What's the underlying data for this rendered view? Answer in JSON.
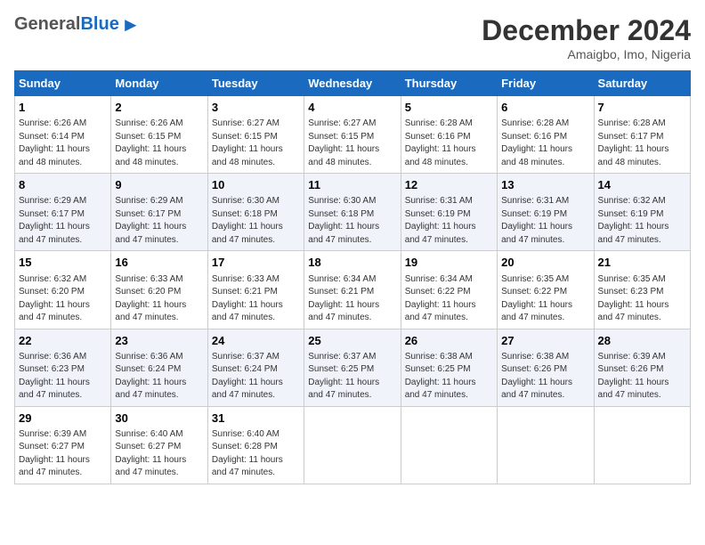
{
  "header": {
    "logo_general": "General",
    "logo_blue": "Blue",
    "month": "December 2024",
    "location": "Amaigbo, Imo, Nigeria"
  },
  "weekdays": [
    "Sunday",
    "Monday",
    "Tuesday",
    "Wednesday",
    "Thursday",
    "Friday",
    "Saturday"
  ],
  "weeks": [
    [
      {
        "day": "1",
        "sunrise": "6:26 AM",
        "sunset": "6:14 PM",
        "daylight": "11 hours and 48 minutes."
      },
      {
        "day": "2",
        "sunrise": "6:26 AM",
        "sunset": "6:15 PM",
        "daylight": "11 hours and 48 minutes."
      },
      {
        "day": "3",
        "sunrise": "6:27 AM",
        "sunset": "6:15 PM",
        "daylight": "11 hours and 48 minutes."
      },
      {
        "day": "4",
        "sunrise": "6:27 AM",
        "sunset": "6:15 PM",
        "daylight": "11 hours and 48 minutes."
      },
      {
        "day": "5",
        "sunrise": "6:28 AM",
        "sunset": "6:16 PM",
        "daylight": "11 hours and 48 minutes."
      },
      {
        "day": "6",
        "sunrise": "6:28 AM",
        "sunset": "6:16 PM",
        "daylight": "11 hours and 48 minutes."
      },
      {
        "day": "7",
        "sunrise": "6:28 AM",
        "sunset": "6:17 PM",
        "daylight": "11 hours and 48 minutes."
      }
    ],
    [
      {
        "day": "8",
        "sunrise": "6:29 AM",
        "sunset": "6:17 PM",
        "daylight": "11 hours and 47 minutes."
      },
      {
        "day": "9",
        "sunrise": "6:29 AM",
        "sunset": "6:17 PM",
        "daylight": "11 hours and 47 minutes."
      },
      {
        "day": "10",
        "sunrise": "6:30 AM",
        "sunset": "6:18 PM",
        "daylight": "11 hours and 47 minutes."
      },
      {
        "day": "11",
        "sunrise": "6:30 AM",
        "sunset": "6:18 PM",
        "daylight": "11 hours and 47 minutes."
      },
      {
        "day": "12",
        "sunrise": "6:31 AM",
        "sunset": "6:19 PM",
        "daylight": "11 hours and 47 minutes."
      },
      {
        "day": "13",
        "sunrise": "6:31 AM",
        "sunset": "6:19 PM",
        "daylight": "11 hours and 47 minutes."
      },
      {
        "day": "14",
        "sunrise": "6:32 AM",
        "sunset": "6:19 PM",
        "daylight": "11 hours and 47 minutes."
      }
    ],
    [
      {
        "day": "15",
        "sunrise": "6:32 AM",
        "sunset": "6:20 PM",
        "daylight": "11 hours and 47 minutes."
      },
      {
        "day": "16",
        "sunrise": "6:33 AM",
        "sunset": "6:20 PM",
        "daylight": "11 hours and 47 minutes."
      },
      {
        "day": "17",
        "sunrise": "6:33 AM",
        "sunset": "6:21 PM",
        "daylight": "11 hours and 47 minutes."
      },
      {
        "day": "18",
        "sunrise": "6:34 AM",
        "sunset": "6:21 PM",
        "daylight": "11 hours and 47 minutes."
      },
      {
        "day": "19",
        "sunrise": "6:34 AM",
        "sunset": "6:22 PM",
        "daylight": "11 hours and 47 minutes."
      },
      {
        "day": "20",
        "sunrise": "6:35 AM",
        "sunset": "6:22 PM",
        "daylight": "11 hours and 47 minutes."
      },
      {
        "day": "21",
        "sunrise": "6:35 AM",
        "sunset": "6:23 PM",
        "daylight": "11 hours and 47 minutes."
      }
    ],
    [
      {
        "day": "22",
        "sunrise": "6:36 AM",
        "sunset": "6:23 PM",
        "daylight": "11 hours and 47 minutes."
      },
      {
        "day": "23",
        "sunrise": "6:36 AM",
        "sunset": "6:24 PM",
        "daylight": "11 hours and 47 minutes."
      },
      {
        "day": "24",
        "sunrise": "6:37 AM",
        "sunset": "6:24 PM",
        "daylight": "11 hours and 47 minutes."
      },
      {
        "day": "25",
        "sunrise": "6:37 AM",
        "sunset": "6:25 PM",
        "daylight": "11 hours and 47 minutes."
      },
      {
        "day": "26",
        "sunrise": "6:38 AM",
        "sunset": "6:25 PM",
        "daylight": "11 hours and 47 minutes."
      },
      {
        "day": "27",
        "sunrise": "6:38 AM",
        "sunset": "6:26 PM",
        "daylight": "11 hours and 47 minutes."
      },
      {
        "day": "28",
        "sunrise": "6:39 AM",
        "sunset": "6:26 PM",
        "daylight": "11 hours and 47 minutes."
      }
    ],
    [
      {
        "day": "29",
        "sunrise": "6:39 AM",
        "sunset": "6:27 PM",
        "daylight": "11 hours and 47 minutes."
      },
      {
        "day": "30",
        "sunrise": "6:40 AM",
        "sunset": "6:27 PM",
        "daylight": "11 hours and 47 minutes."
      },
      {
        "day": "31",
        "sunrise": "6:40 AM",
        "sunset": "6:28 PM",
        "daylight": "11 hours and 47 minutes."
      },
      null,
      null,
      null,
      null
    ]
  ],
  "labels": {
    "sunrise": "Sunrise:",
    "sunset": "Sunset:",
    "daylight": "Daylight:"
  }
}
